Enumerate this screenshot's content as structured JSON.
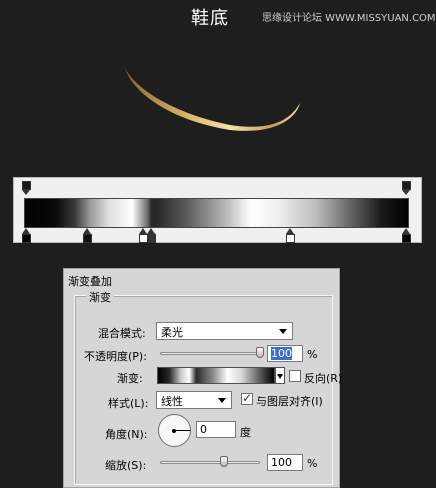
{
  "header": {
    "title": "鞋底",
    "watermark": "思缘设计论坛 WWW.MISSYUAN.COM"
  },
  "gradient_editor": {
    "opacity_stops": 2,
    "color_stops": 7
  },
  "dialog": {
    "title": "渐变叠加",
    "group_label": "渐变",
    "blend_mode_label": "混合模式:",
    "blend_mode_value": "柔光",
    "opacity_label": "不透明度(P):",
    "opacity_value": "100",
    "opacity_percent": 100,
    "opacity_unit": "%",
    "gradient_label": "渐变:",
    "reverse_label": "反向(R)",
    "reverse_checked": false,
    "style_label": "样式(L):",
    "style_value": "线性",
    "align_label": "与图层对齐(I)",
    "align_checked": true,
    "angle_label": "角度(N):",
    "angle_value": "0",
    "angle_unit": "度",
    "scale_label": "缩放(S):",
    "scale_value": "100",
    "scale_percent": 100,
    "scale_unit": "%"
  },
  "colors": {
    "background": "#1e1e1e",
    "sole_light": "#f0dca0",
    "sole_dark": "#a27c3a",
    "selection": "#3a6ed6"
  }
}
